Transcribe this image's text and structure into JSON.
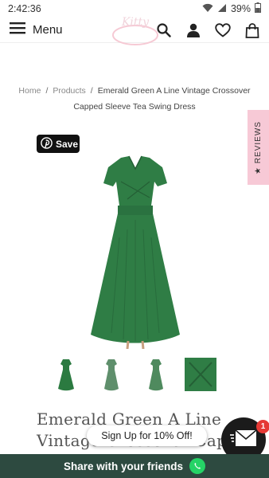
{
  "status_bar": {
    "time": "2:42:36",
    "battery": "39%"
  },
  "header": {
    "menu_label": "Menu",
    "icons": [
      "search-icon",
      "account-icon",
      "heart-icon",
      "bag-icon"
    ]
  },
  "breadcrumb": {
    "home": "Home",
    "separator": "/",
    "products": "Products",
    "current": "Emerald Green A Line Vintage Crossover Capped Sleeve Tea Swing Dress"
  },
  "reviews_tab": {
    "label": "★ REVIEWS"
  },
  "pin_button": {
    "label": "Save"
  },
  "product": {
    "title": "Emerald Green A Line Vintage Crossover Capped Sleeve Tea Swing Dress",
    "dress_color": "#2f7d45"
  },
  "signup": {
    "label": "Sign Up for 10% Off!"
  },
  "mail": {
    "badge_count": "1"
  },
  "share": {
    "label": "Share with your friends"
  },
  "colors": {
    "share_bar": "#2d4a40",
    "reviews_tab": "#f7c9d6",
    "whatsapp": "#25d366",
    "badge": "#e53935"
  }
}
